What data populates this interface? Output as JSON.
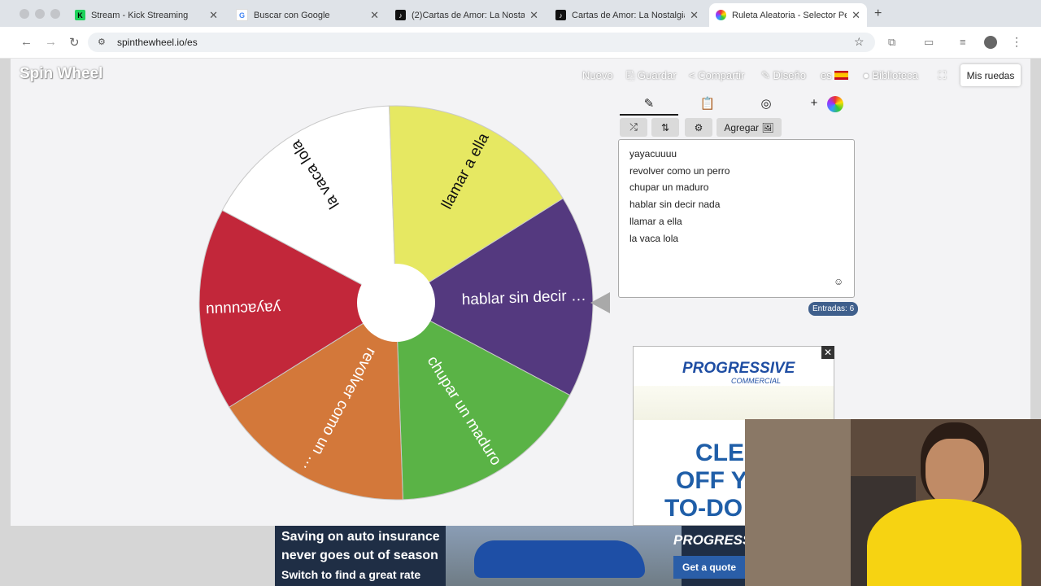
{
  "browser": {
    "tabs": [
      {
        "title": "Stream - Kick Streaming",
        "favicon": "kick-icon",
        "active": false
      },
      {
        "title": "Buscar con Google",
        "favicon": "google-icon",
        "active": false
      },
      {
        "title": "(2)Cartas de Amor: La Nostalg",
        "favicon": "tiktok-icon",
        "active": false
      },
      {
        "title": "Cartas de Amor: La Nostalgia",
        "favicon": "tiktok-icon",
        "active": false
      },
      {
        "title": "Ruleta Aleatoria - Selector Pe",
        "favicon": "wheel-icon",
        "active": true
      }
    ],
    "url": "spinthewheel.io/es"
  },
  "site": {
    "logo": "Spin Wheel",
    "nav": {
      "nuevo": "Nuevo",
      "guardar": "Guardar",
      "compartir": "Compartir",
      "diseno": "Diseño",
      "lang": "es",
      "biblioteca": "Biblioteca"
    },
    "mis_ruedas": "Mis ruedas"
  },
  "wheel": {
    "segments": [
      {
        "label": "hablar sin decir …",
        "color": "#54397f"
      },
      {
        "label": "chupar un maduro",
        "color": "#5ab346"
      },
      {
        "label": "revolver como un …",
        "color": "#d3783a"
      },
      {
        "label": "yayacuuuu",
        "color": "#c2273a"
      },
      {
        "label": "la vaca lola",
        "color": "#ffffff"
      },
      {
        "label": "llamar a ella",
        "color": "#e6e862"
      }
    ]
  },
  "editor": {
    "agregar_label": "Agregar",
    "entries": [
      "yayacuuuu",
      "revolver como un perro",
      "chupar un maduro",
      "hablar sin decir nada",
      "llamar a ella",
      "la vaca lola"
    ],
    "count_label": "Entradas: 6"
  },
  "ads": {
    "box": {
      "brand": "PROGRESSIVE",
      "sub": "COMMERCIAL",
      "headline": [
        "CLEA",
        "OFF YO",
        "TO-DO"
      ]
    },
    "banner": {
      "line1": "Saving on auto insurance",
      "line2": "never goes out of season",
      "line3": "Switch to find a great rate",
      "brand": "PROGRESSIVE",
      "cta": "Get a quote"
    }
  }
}
